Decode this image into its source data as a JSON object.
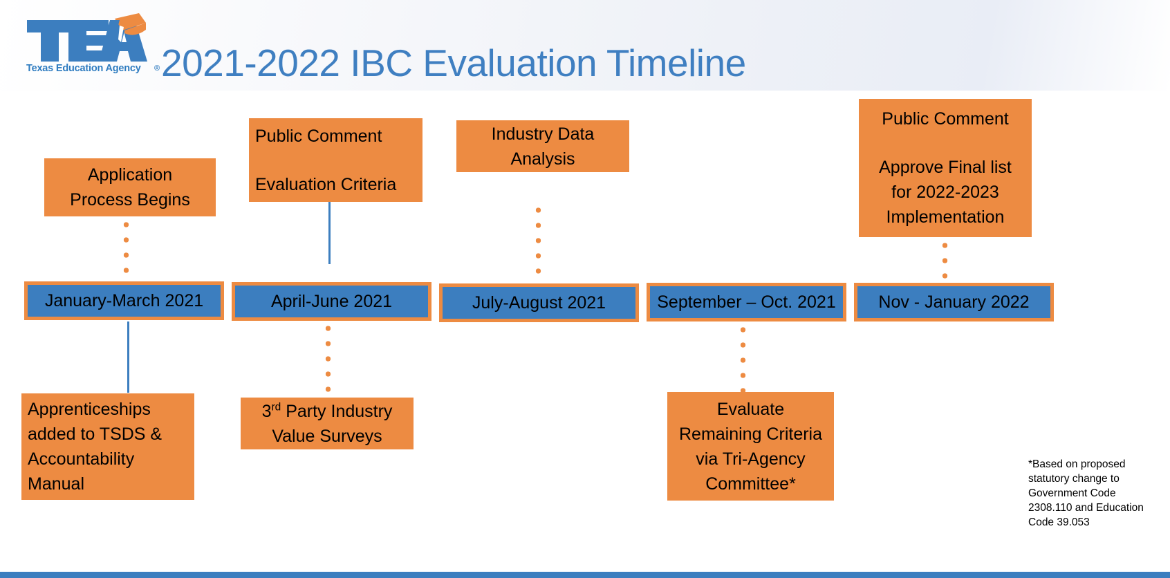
{
  "header": {
    "title": "2021-2022 IBC Evaluation Timeline",
    "logo": {
      "mark_text": "TEA",
      "tagline": "Texas Education Agency",
      "registered_mark": "®",
      "brand_blue": "#3C7EBF",
      "brand_orange": "#ED8B42"
    }
  },
  "colors": {
    "orange_box": "#ED8B42",
    "blue_box": "#3C7EBF",
    "title_blue": "#3F7FC1",
    "text_black": "#000000",
    "header_band": "#EEF1F7"
  },
  "timeline": {
    "periods": [
      {
        "label": "January-March 2021"
      },
      {
        "label": "April-June 2021"
      },
      {
        "label": "July-August 2021"
      },
      {
        "label": "September – Oct. 2021"
      },
      {
        "label": "Nov - January 2022"
      }
    ],
    "above_events": [
      {
        "id": "application-process",
        "line1": "Application",
        "line2": "Process Begins",
        "connector": "dotted-orange",
        "period": "January-March 2021"
      },
      {
        "id": "public-comment-evaluation-criteria",
        "line1": "Public Comment",
        "line2": "Evaluation Criteria",
        "connector": "solid-blue",
        "period": "April-June 2021"
      },
      {
        "id": "industry-data-analysis",
        "line1": "Industry Data",
        "line2": "Analysis",
        "connector": "dotted-orange",
        "period": "July-August 2021"
      },
      {
        "id": "public-comment-approve-final-list",
        "line1": "Public Comment",
        "line2": "Approve Final list",
        "line3": "for 2022-2023",
        "line4": "Implementation",
        "connector": "dotted-orange",
        "period": "Nov - January 2022"
      }
    ],
    "below_events": [
      {
        "id": "apprenticeships-tsds",
        "line1": "Apprenticeships",
        "line2": "added to TSDS &",
        "line3": "Accountability",
        "line4": "Manual",
        "connector": "solid-blue",
        "period": "January-March 2021"
      },
      {
        "id": "third-party-industry-value-surveys",
        "line1_prefix": "3",
        "line1_sup": "rd",
        "line1_rest": " Party Industry",
        "line2": "Value Surveys",
        "connector": "dotted-orange",
        "period": "April-June 2021"
      },
      {
        "id": "evaluate-remaining-criteria",
        "line1": "Evaluate",
        "line2": "Remaining Criteria",
        "line3": "via Tri-Agency",
        "line4": "Committee*",
        "connector": "dotted-orange",
        "period": "September – Oct. 2021"
      }
    ]
  },
  "footnote": {
    "line1": "*Based on proposed",
    "line2": "statutory change to",
    "line3": "Government Code",
    "line4": "2308.110 and Education",
    "line5": "Code 39.053"
  }
}
